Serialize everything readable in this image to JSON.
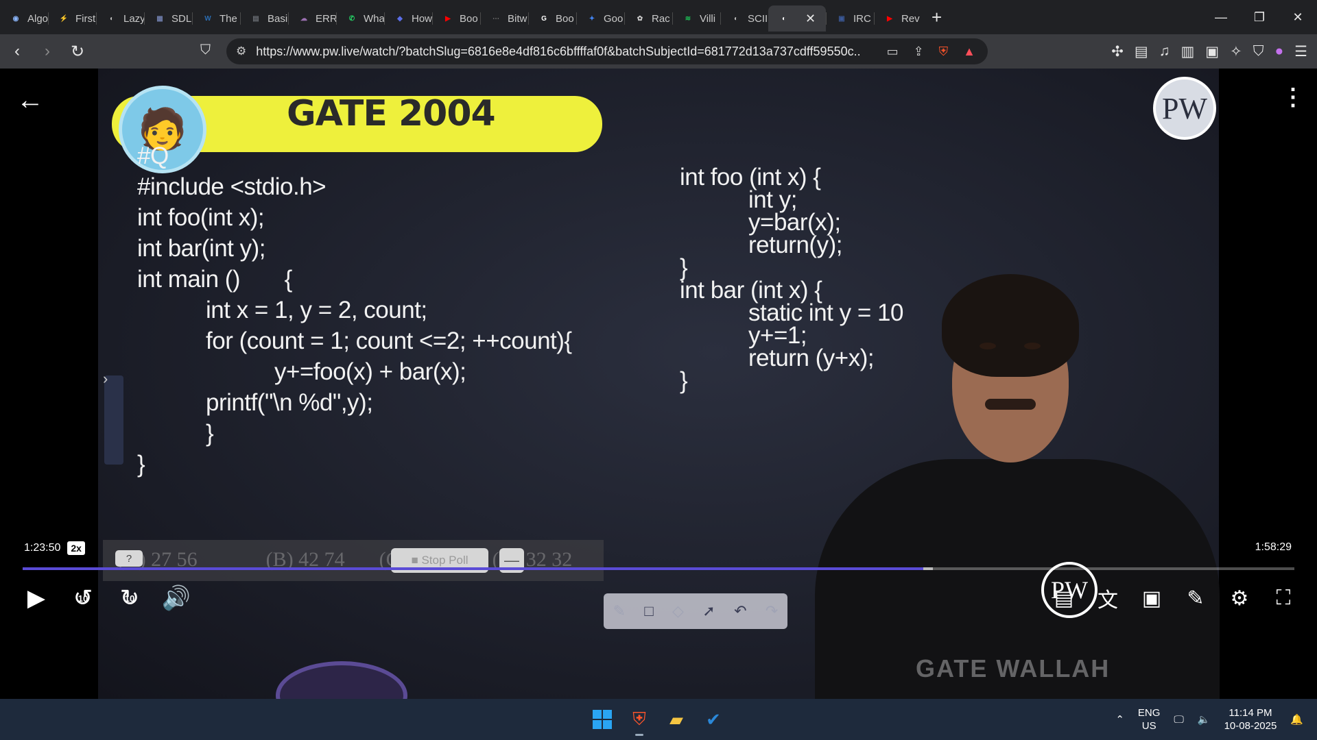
{
  "browser": {
    "tabs": [
      {
        "label": "Algo",
        "color": "#8ab4f8",
        "glyph": "◉"
      },
      {
        "label": "First",
        "color": "#f4b400",
        "glyph": "⚡"
      },
      {
        "label": "Lazy",
        "color": "#bdbdbd",
        "glyph": "◐"
      },
      {
        "label": "SDL",
        "color": "#6d7ba8",
        "glyph": "▦"
      },
      {
        "label": "The",
        "color": "#2b6cb0",
        "glyph": "W"
      },
      {
        "label": "Basi",
        "color": "#666a70",
        "glyph": "▤"
      },
      {
        "label": "ERR",
        "color": "#9a6fb0",
        "glyph": "☁"
      },
      {
        "label": "Wha",
        "color": "#25d366",
        "glyph": "✆"
      },
      {
        "label": "How",
        "color": "#5b6ee8",
        "glyph": "◆"
      },
      {
        "label": "Boo",
        "color": "#ff0000",
        "glyph": "▶"
      },
      {
        "label": "Bitw",
        "color": "#777777",
        "glyph": "⋯"
      },
      {
        "label": "Boo",
        "color": "#ffffff",
        "glyph": "G"
      },
      {
        "label": "Goo",
        "color": "#4285f4",
        "glyph": "✦"
      },
      {
        "label": "Rac",
        "color": "#cccccc",
        "glyph": "✿"
      },
      {
        "label": "Villi",
        "color": "#1db954",
        "glyph": "≋"
      },
      {
        "label": "SCII",
        "color": "#bdbdbd",
        "glyph": "◐"
      }
    ],
    "active_tab": {
      "label": "",
      "glyph": "◐"
    },
    "after_tabs": [
      {
        "label": "IRC",
        "color": "#3b5998",
        "glyph": "▣"
      },
      {
        "label": "Rev",
        "color": "#ff0000",
        "glyph": "▶"
      }
    ],
    "new_tab_label": "+",
    "url": "https://www.pw.live/watch/?batchSlug=6816e8e4df816c6bffffaf0f&batchSubjectId=681772d13a737cdff59550c...",
    "shield_badge": "3"
  },
  "slide": {
    "banner_title": "GATE 2004",
    "question_tag": "#Q",
    "code_left": [
      {
        "indent": 0,
        "text": "#include <stdio.h>"
      },
      {
        "indent": 0,
        "text": "int foo(int x);"
      },
      {
        "indent": 0,
        "text": "int bar(int y);"
      },
      {
        "indent": 0,
        "text": "int main ()       {"
      },
      {
        "indent": 1,
        "text": "int x = 1, y = 2, count;"
      },
      {
        "indent": 1,
        "text": "for (count = 1; count <=2; ++count){"
      },
      {
        "indent": 2,
        "text": "y+=foo(x) + bar(x);"
      },
      {
        "indent": 1,
        "text": "printf(\"\\n %d\",y);"
      },
      {
        "indent": 1,
        "text": "}"
      },
      {
        "indent": 0,
        "text": "}"
      }
    ],
    "code_right": [
      {
        "indent": 0,
        "text": "int foo (int x) {"
      },
      {
        "indent": 1,
        "text": "int y;"
      },
      {
        "indent": 1,
        "text": "y=bar(x);"
      },
      {
        "indent": 1,
        "text": "return(y);"
      },
      {
        "indent": 0,
        "text": "}"
      },
      {
        "indent": 0,
        "text": "int bar (int x) {"
      },
      {
        "indent": 1,
        "text": "static int y = 10"
      },
      {
        "indent": 1,
        "text": "y+=1;"
      },
      {
        "indent": 1,
        "text": "return (y+x);"
      },
      {
        "indent": 0,
        "text": "}"
      }
    ],
    "options": [
      {
        "label": "(A)  27  56"
      },
      {
        "label": "(B) 42 74"
      },
      {
        "label": "(C) 33 37"
      },
      {
        "label": "(D) 32 32"
      }
    ],
    "logo_text": "PW",
    "shirt_logo_text": "PW",
    "overlay_text": "GATE WALLAH"
  },
  "poll": {
    "help_label": "?",
    "stop_label": "■ Stop Poll",
    "minimize_label": "—"
  },
  "player": {
    "current_time": "1:23:50",
    "speed": "2x",
    "duration": "1:58:29",
    "played_fraction": 0.708,
    "buffered_fraction": 0.716,
    "seek_back": "10",
    "seek_forward": "10"
  },
  "taskbar": {
    "lang_line1": "ENG",
    "lang_line2": "US",
    "time": "11:14 PM",
    "date": "10-08-2025"
  }
}
